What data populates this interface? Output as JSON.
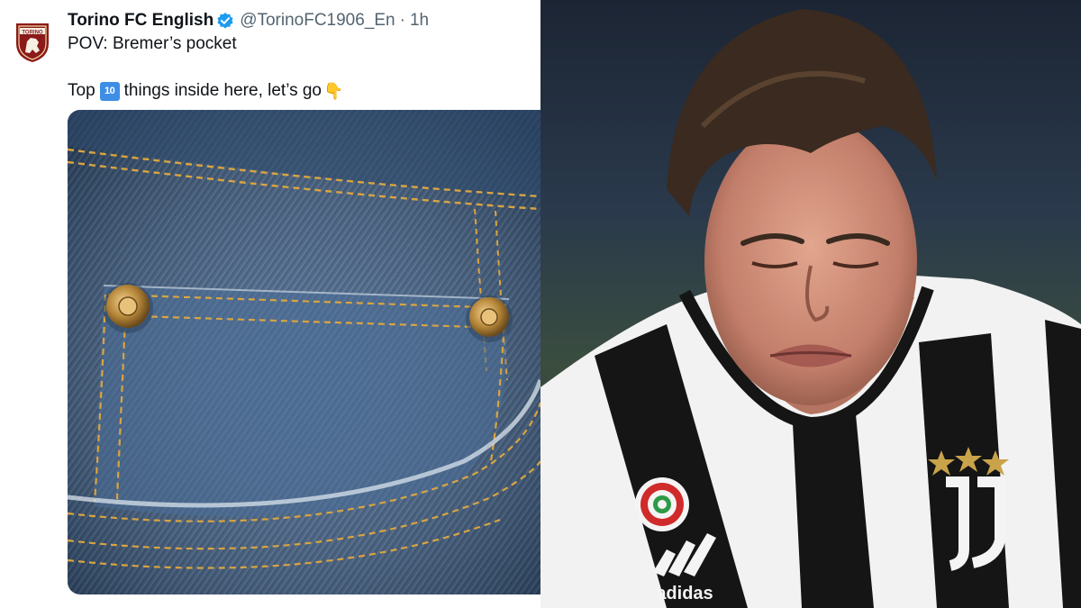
{
  "tweet": {
    "display_name": "Torino FC English",
    "handle": "@TorinoFC1906_En",
    "separator": "·",
    "time": "1h",
    "line1": "POV: Bremer’s pocket",
    "line2_before": "Top",
    "line2_emoji": "10",
    "line2_after": "things inside here, let’s go",
    "line2_end_emoji": "👇",
    "avatar_label": "TORINO"
  },
  "media": {
    "photo_left": "jeans-pocket-photo",
    "photo_right": "footballer-grimace-photo",
    "shirt_brand": "adidas"
  },
  "colors": {
    "verified": "#1d9bf0",
    "denim": "#3f5f86",
    "stitch": "#d9a441",
    "torino_maroon": "#8b1a1a"
  }
}
